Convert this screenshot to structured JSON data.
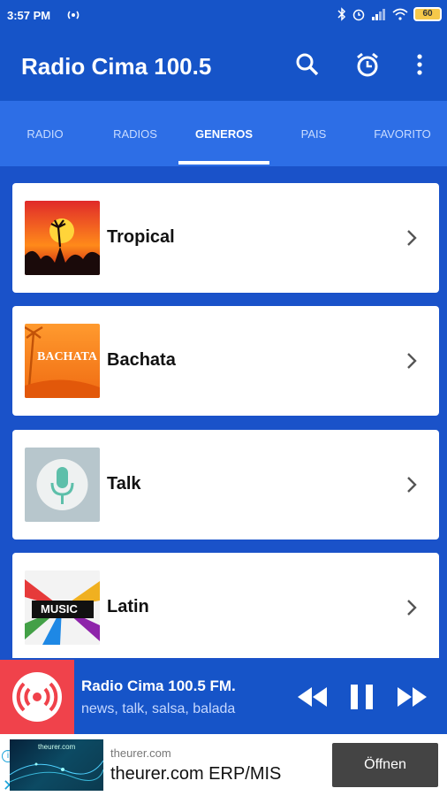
{
  "status_bar": {
    "time": "3:57 PM",
    "battery": "60"
  },
  "app_bar": {
    "title": "Radio Cima 100.5"
  },
  "tabs": [
    {
      "label": "RADIO"
    },
    {
      "label": "RADIOS"
    },
    {
      "label": "GENEROS",
      "active": true
    },
    {
      "label": "PAIS"
    },
    {
      "label": "FAVORITO"
    }
  ],
  "genres": [
    {
      "label": "Tropical",
      "thumb_text": ""
    },
    {
      "label": "Bachata",
      "thumb_text": "BACHATA"
    },
    {
      "label": "Talk",
      "thumb_text": ""
    },
    {
      "label": "Latin",
      "thumb_text": "MUSIC"
    }
  ],
  "player": {
    "station": "Radio Cima 100.5 FM.",
    "tags": "news, talk, salsa, balada"
  },
  "ad": {
    "domain": "theurer.com",
    "headline": "theurer.com ERP/MIS",
    "cta": "Öffnen",
    "thumb_text": "theurer.com"
  },
  "colors": {
    "primary": "#1654c8",
    "tab_bar": "#2d6ee6",
    "player_logo": "#f0424b"
  }
}
